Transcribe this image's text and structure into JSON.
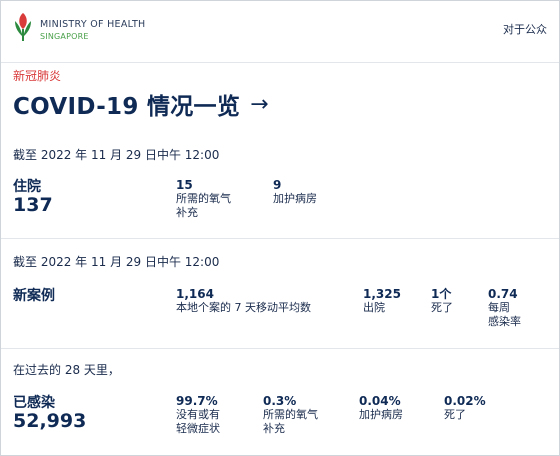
{
  "header": {
    "org_name": "MINISTRY OF HEALTH",
    "org_sub": "SINGAPORE",
    "link": "对于公众"
  },
  "eyebrow": "新冠肺炎",
  "title": "COVID-19 情况一览",
  "arrow": "→",
  "hospital": {
    "asof": "截至 2022 年 11 月 29 日中午 12:00",
    "label": "住院",
    "value": "137",
    "stats": [
      {
        "value": "15",
        "label_lines": [
          "所需的氧气",
          "补充"
        ]
      },
      {
        "value": "9",
        "label_lines": [
          "加护病房"
        ]
      }
    ]
  },
  "cases": {
    "asof": "截至 2022 年 11 月 29 日中午 12:00",
    "label": "新案例",
    "stats": [
      {
        "value": "1,164",
        "label_lines": [
          "本地个案的 7 天移动平均数"
        ]
      },
      {
        "value": "1,325",
        "label_lines": [
          "出院"
        ]
      },
      {
        "value": "1个",
        "label_lines": [
          "死了"
        ]
      },
      {
        "value": "0.74",
        "label_lines": [
          "每周",
          "感染率"
        ]
      }
    ]
  },
  "infected": {
    "period": "在过去的 28 天里，",
    "label": "已感染",
    "value": "52,993",
    "stats": [
      {
        "value": "99.7%",
        "label_lines": [
          "没有或有",
          "轻微症状"
        ]
      },
      {
        "value": "0.3%",
        "label_lines": [
          "所需的氧气",
          "补充"
        ]
      },
      {
        "value": "0.04%",
        "label_lines": [
          "加护病房"
        ]
      },
      {
        "value": "0.02%",
        "label_lines": [
          "死了"
        ]
      }
    ]
  }
}
